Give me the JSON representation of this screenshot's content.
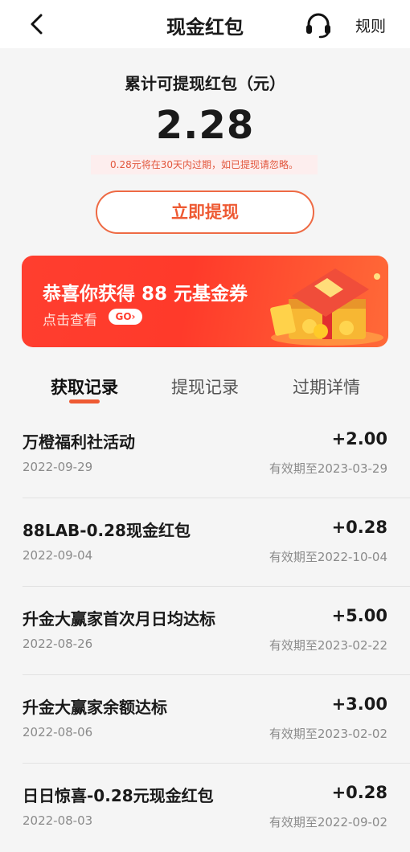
{
  "header": {
    "title": "现金红包",
    "rules_label": "规则"
  },
  "summary": {
    "label": "累计可提现红包（元）",
    "amount": "2.28",
    "expire_note": "0.28元将在30天内过期，如已提现请忽略。",
    "withdraw_label": "立即提现"
  },
  "banner": {
    "title": "恭喜你获得 88 元基金券",
    "subtitle": "点击查看",
    "go_label": "GO"
  },
  "tabs": [
    {
      "label": "获取记录",
      "active": true
    },
    {
      "label": "提现记录",
      "active": false
    },
    {
      "label": "过期详情",
      "active": false
    }
  ],
  "records": [
    {
      "name": "万橙福利社活动",
      "amount": "+2.00",
      "date": "2022-09-29",
      "valid": "有效期至2023-03-29"
    },
    {
      "name": "88LAB-0.28现金红包",
      "amount": "+0.28",
      "date": "2022-09-04",
      "valid": "有效期至2022-10-04"
    },
    {
      "name": "升金大赢家首次月日均达标",
      "amount": "+5.00",
      "date": "2022-08-26",
      "valid": "有效期至2023-02-22"
    },
    {
      "name": "升金大赢家余额达标",
      "amount": "+3.00",
      "date": "2022-08-06",
      "valid": "有效期至2023-02-02"
    },
    {
      "name": "日日惊喜-0.28元现金红包",
      "amount": "+0.28",
      "date": "2022-08-03",
      "valid": "有效期至2022-09-02"
    }
  ],
  "colors": {
    "accent": "#ee5a33",
    "banner_red": "#ff3e2f",
    "text_gray": "#8a8a8a"
  },
  "icons": {
    "back": "chevron-left-icon",
    "support": "headset-icon",
    "gift": "gift-box-illustration"
  }
}
